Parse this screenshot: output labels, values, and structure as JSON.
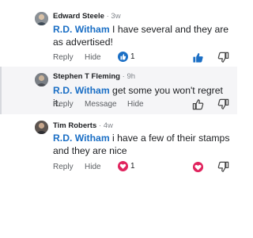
{
  "colors": {
    "mention": "#1b6fc5",
    "like_active": "#1b6fc5",
    "heart_active": "#e0245e",
    "highlight_background": "#f5f5f7"
  },
  "comments": [
    {
      "author": "Edward Steele",
      "separator": "·",
      "time": "3w",
      "mention": "R.D. Witham",
      "text": " I have several and they are as advertised!",
      "actions": [
        "Reply",
        "Hide"
      ],
      "reaction": {
        "icon": "thumbs-up-icon",
        "count": "1"
      },
      "liked": true
    },
    {
      "author": "Stephen T Fleming",
      "separator": "·",
      "time": "9h",
      "mention": "R.D. Witham",
      "text": " get some you won't regret it.",
      "actions": [
        "Reply",
        "Message",
        "Hide"
      ],
      "liked": false
    },
    {
      "author": "Tim Roberts",
      "separator": "·",
      "time": "4w",
      "mention": "R.D. Witham",
      "text": " i have a few of their stamps and they are nice",
      "actions": [
        "Reply",
        "Hide"
      ],
      "reaction": {
        "icon": "heart-icon",
        "count": "1"
      },
      "loved": true
    }
  ]
}
